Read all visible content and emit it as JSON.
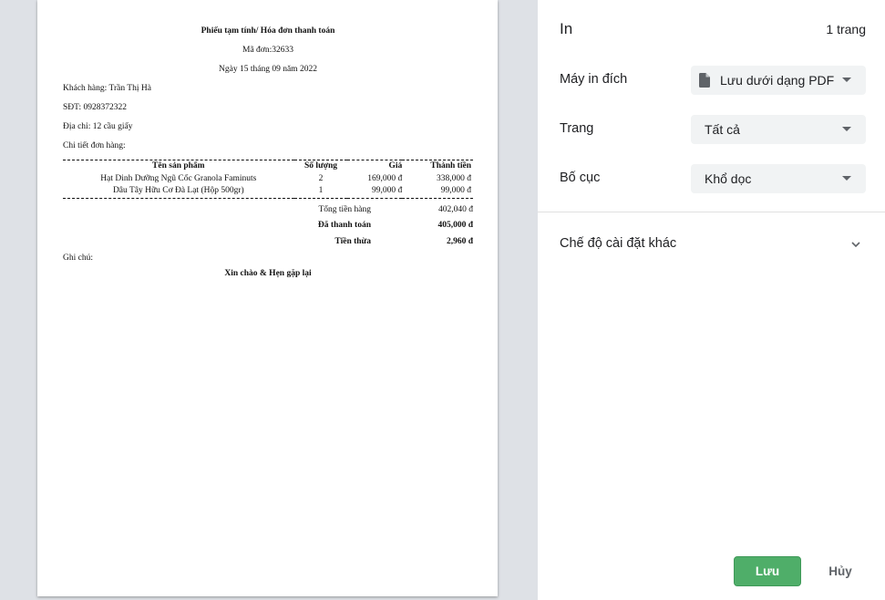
{
  "document": {
    "title": "Phiếu tạm tính/ Hóa đơn thanh toán",
    "order_number": "Mã đơn:32633",
    "date": "Ngày 15 tháng 09 năm 2022",
    "customer": "Khách hàng: Trần Thị Hà",
    "phone": "SĐT: 0928372322",
    "address": "Địa chỉ: 12 cầu giấy",
    "details_label": "Chi tiết đơn hàng:",
    "table": {
      "headers": [
        "Tên sản phẩm",
        "Số lượng",
        "Giá",
        "Thành tiền"
      ],
      "rows": [
        [
          "Hạt Dinh Dưỡng Ngũ Cốc Granola Faminuts",
          "2",
          "169,000 đ",
          "338,000 đ"
        ],
        [
          "Dâu Tây Hữu Cơ Đà Lạt (Hộp 500gr)",
          "1",
          "99,000 đ",
          "99,000 đ"
        ]
      ]
    },
    "totals": {
      "subtotal_label": "Tổng tiền hàng",
      "subtotal_value": "402,040 đ",
      "paid_label": "Đã thanh toán",
      "paid_value": "405,000 đ",
      "change_label": "Tiền thừa",
      "change_value": "2,960 đ"
    },
    "note_label": "Ghi chú:",
    "farewell": "Xin chào & Hẹn gặp lại"
  },
  "panel": {
    "title": "In",
    "page_count": "1 trang",
    "destination": {
      "label": "Máy in đích",
      "value": "Lưu dưới dạng PDF",
      "icon": "file-icon"
    },
    "pages": {
      "label": "Trang",
      "value": "Tất cả"
    },
    "layout": {
      "label": "Bố cục",
      "value": "Khổ dọc"
    },
    "more_settings": "Chế độ cài đặt khác",
    "save_button": "Lưu",
    "cancel_button": "Hủy"
  },
  "colors": {
    "preview_bg": "#dee1e6",
    "save_button": "#4fae69",
    "select_bg": "#f1f3f4",
    "text": "#202124"
  }
}
